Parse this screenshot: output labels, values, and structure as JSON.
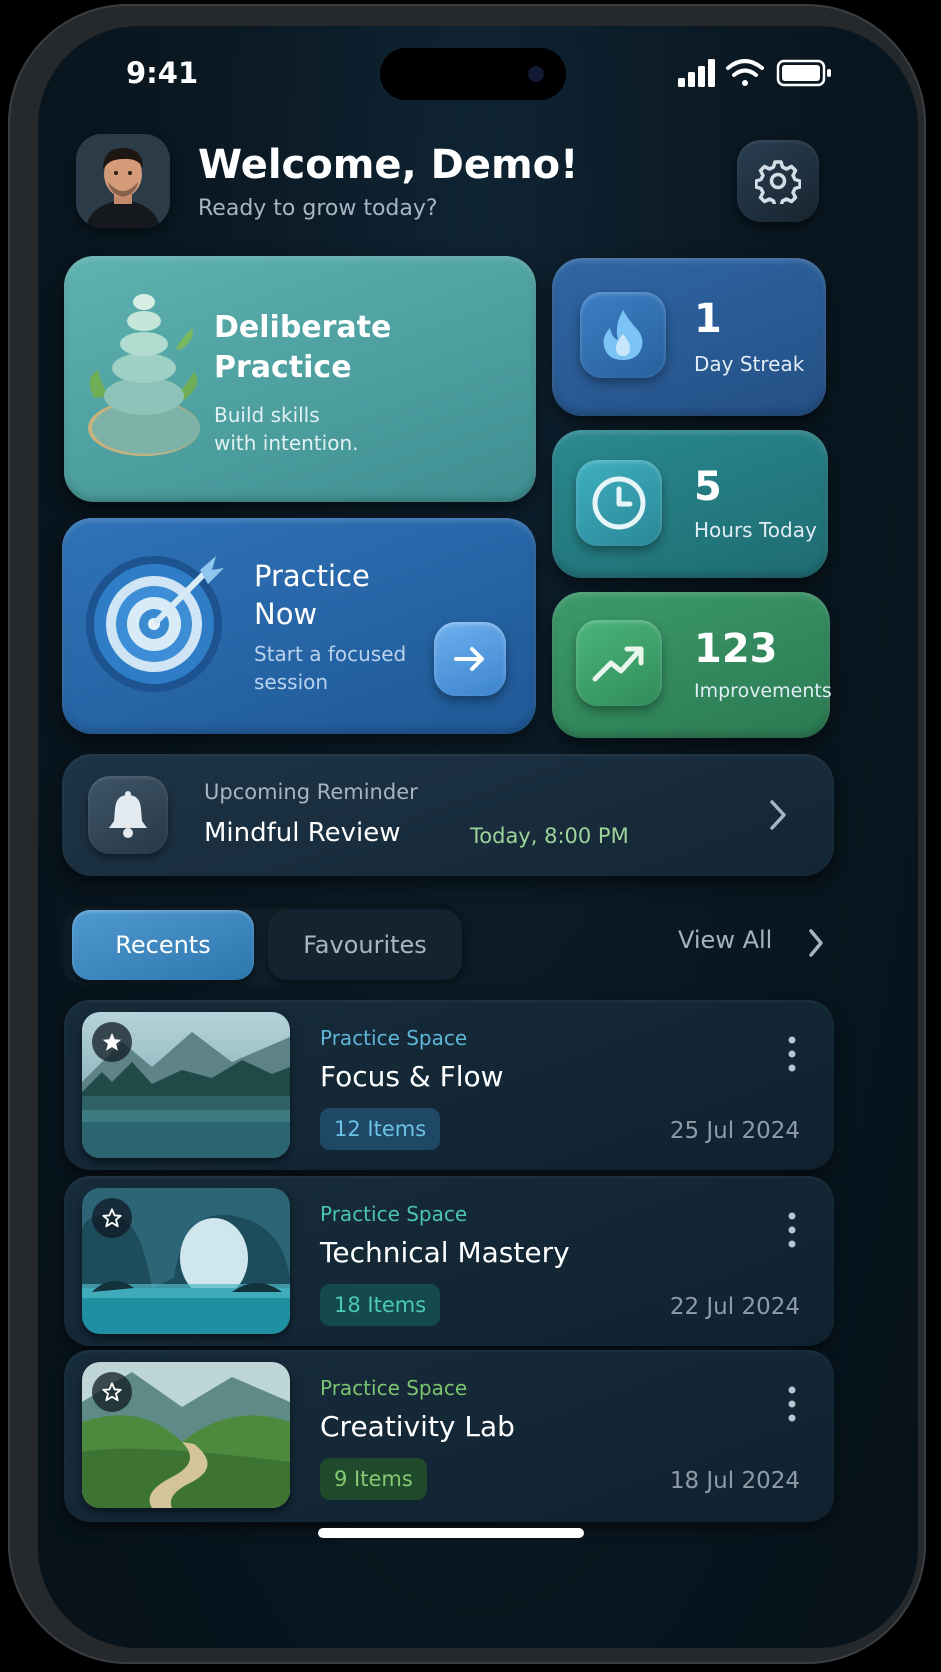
{
  "status": {
    "time": "9:41"
  },
  "header": {
    "welcome": "Welcome, Demo!",
    "subtitle": "Ready to grow today?"
  },
  "cards": {
    "deliberate": {
      "title_line1": "Deliberate",
      "title_line2": "Practice",
      "sub_line1": "Build skills",
      "sub_line2": "with intention."
    },
    "practice": {
      "title_line1": "Practice",
      "title_line2": "Now",
      "sub_line1": "Start a focused",
      "sub_line2": "session"
    }
  },
  "stats": [
    {
      "value": "1",
      "label": "Day Streak",
      "icon": "flame-icon",
      "color": "#2f66a5"
    },
    {
      "value": "5",
      "label": "Hours Today",
      "icon": "clock-icon",
      "color": "#2a8a90"
    },
    {
      "value": "123",
      "label": "Improvements",
      "icon": "trend-up-icon",
      "color": "#3c9a6b"
    }
  ],
  "reminder": {
    "label": "Upcoming Reminder",
    "title": "Mindful Review",
    "time": "Today, 8:00 PM"
  },
  "tabs": {
    "recents": "Recents",
    "favourites": "Favourites",
    "view_all": "View All"
  },
  "items": [
    {
      "label": "Practice Space",
      "title": "Focus & Flow",
      "count": "12 Items",
      "date": "25 Jul 2024",
      "starred": true,
      "accent": "#5fb7d8"
    },
    {
      "label": "Practice Space",
      "title": "Technical Mastery",
      "count": "18 Items",
      "date": "22 Jul 2024",
      "starred": false,
      "accent": "#4cc3b4"
    },
    {
      "label": "Practice Space",
      "title": "Creativity Lab",
      "count": "9 Items",
      "date": "18 Jul 2024",
      "starred": false,
      "accent": "#7cc46f"
    }
  ]
}
